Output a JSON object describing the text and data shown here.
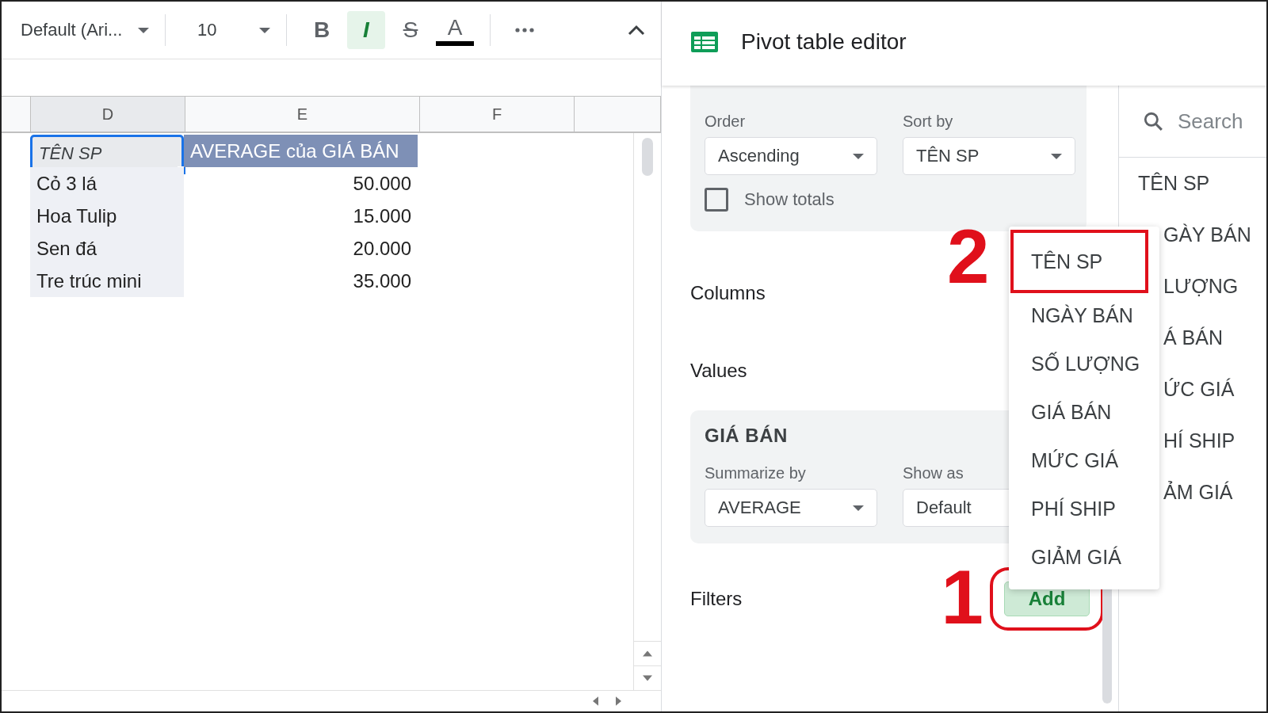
{
  "toolbar": {
    "font": "Default (Ari...",
    "font_size": "10",
    "format_buttons": [
      {
        "label": "B",
        "kind": "bold",
        "on": false
      },
      {
        "label": "I",
        "kind": "italic",
        "on": true
      },
      {
        "label": "S",
        "kind": "strike",
        "on": false
      },
      {
        "label": "A",
        "kind": "color",
        "on": false
      }
    ]
  },
  "sheet": {
    "columns": [
      "D",
      "E",
      "F"
    ],
    "rows": [
      {
        "cells": [
          "TÊN SP",
          "AVERAGE của GIÁ BÁN"
        ],
        "kind": "header",
        "selected": true
      },
      {
        "cells": [
          "Cỏ 3 lá",
          "50.000"
        ],
        "kind": "data",
        "selected": false
      },
      {
        "cells": [
          "Hoa Tulip",
          "15.000"
        ],
        "kind": "data",
        "selected": false
      },
      {
        "cells": [
          "Sen đá",
          "20.000"
        ],
        "kind": "data",
        "selected": false
      },
      {
        "cells": [
          "Tre trúc mini",
          "35.000"
        ],
        "kind": "data",
        "selected": false
      }
    ]
  },
  "panel": {
    "title": "Pivot table editor",
    "rows_card": {
      "order_label": "Order",
      "order_value": "Ascending",
      "sort_label": "Sort by",
      "sort_value": "TÊN SP",
      "show_totals": {
        "label": "Show totals",
        "checked": false
      }
    },
    "columns_label": "Columns",
    "values_label": "Values",
    "value_card": {
      "title": "GIÁ BÁN",
      "summarize_label": "Summarize by",
      "summarize_value": "AVERAGE",
      "show_as_label": "Show as",
      "show_as_value": "Default"
    },
    "filters_label": "Filters",
    "add_button": {
      "label": "Add",
      "highlighted": true,
      "step": "1"
    }
  },
  "fields": {
    "placeholder": "Search",
    "items": [
      "TÊN SP",
      "GÀY BÁN",
      "LƯỢNG",
      "Á BÁN",
      "ỨC GIÁ",
      "HÍ SHIP",
      "ẢM GIÁ"
    ]
  },
  "menu": {
    "step": "2",
    "items": [
      {
        "label": "TÊN SP",
        "highlighted": true
      },
      {
        "label": "NGÀY BÁN",
        "highlighted": false
      },
      {
        "label": "SỐ LƯỢNG",
        "highlighted": false
      },
      {
        "label": "GIÁ BÁN",
        "highlighted": false
      },
      {
        "label": "MỨC GIÁ",
        "highlighted": false
      },
      {
        "label": "PHÍ SHIP",
        "highlighted": false
      },
      {
        "label": "GIẢM GIÁ",
        "highlighted": false
      }
    ]
  }
}
